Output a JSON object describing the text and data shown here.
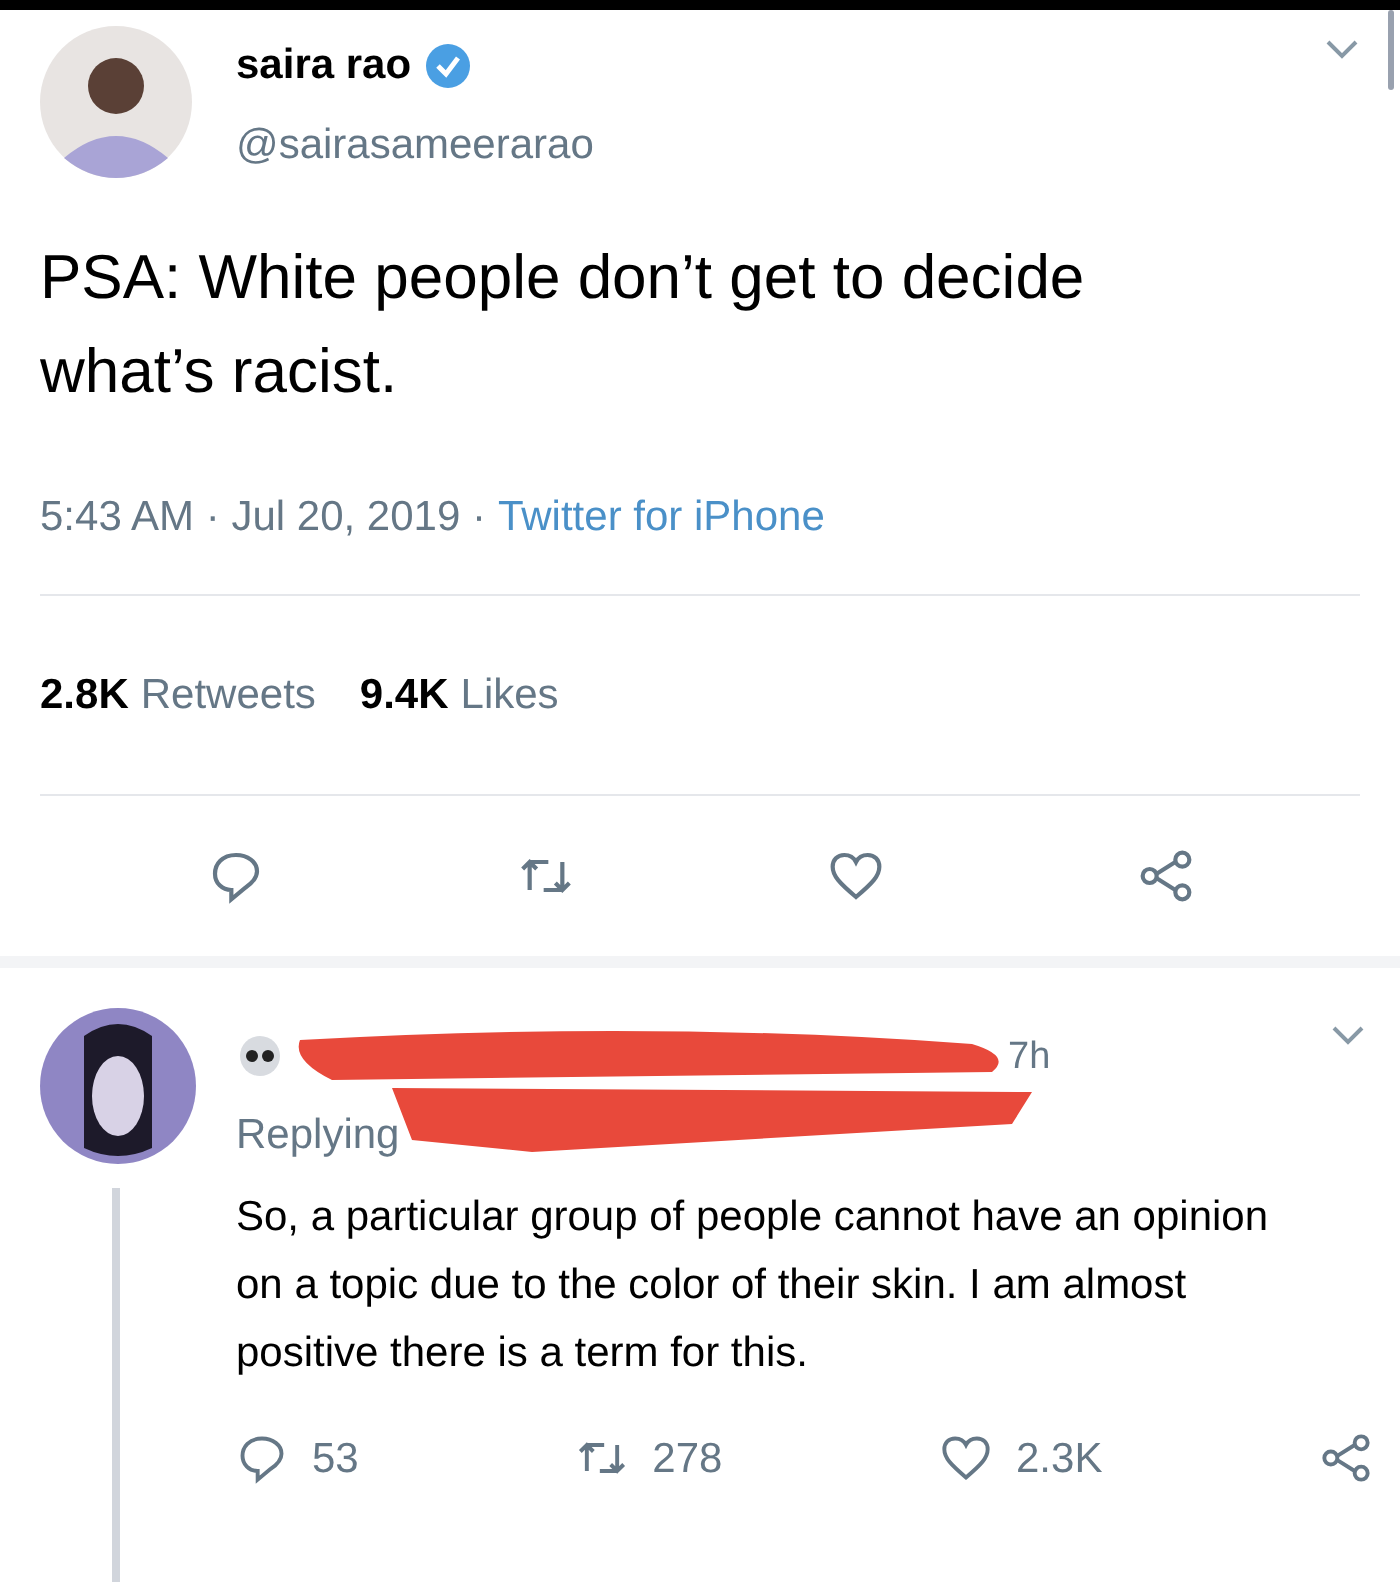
{
  "tweet": {
    "name": "saira rao",
    "verified": true,
    "handle": "@sairasameerarao",
    "text": "PSA: White people don’t get to decide what’s racist.",
    "meta": "5:43 AM · Jul 20, 2019 ·",
    "source": "Twitter for iPhone",
    "stats": [
      {
        "count": "2.8K",
        "label": "Retweets"
      },
      {
        "count": "9.4K",
        "label": "Likes"
      }
    ],
    "actions": [
      {
        "kind": "reply"
      },
      {
        "kind": "retweet"
      },
      {
        "kind": "like"
      },
      {
        "kind": "share"
      }
    ]
  },
  "reply": {
    "time": "7h",
    "replying": "Replying",
    "text": "So, a particular group of people cannot have an opinion on a topic due to the color of their skin. I am almost positive there is a term for this.",
    "actions": [
      {
        "kind": "reply",
        "count": "53"
      },
      {
        "kind": "retweet",
        "count": "278"
      },
      {
        "kind": "like",
        "count": "2.3K"
      },
      {
        "kind": "share"
      }
    ]
  }
}
